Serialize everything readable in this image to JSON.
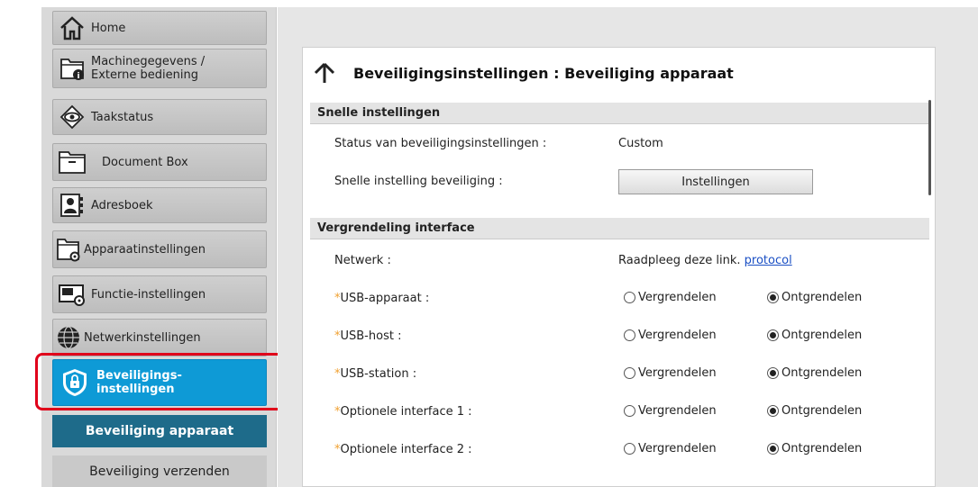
{
  "sidebar": {
    "items": [
      {
        "label": "Home",
        "icon": "home-icon"
      },
      {
        "label_line1": "Machinegegevens /",
        "label_line2": "Externe bediening",
        "icon": "machine-info-icon"
      },
      {
        "label": "Taakstatus",
        "icon": "eye-icon"
      },
      {
        "label": "Document Box",
        "icon": "folder-icon"
      },
      {
        "label": "Adresboek",
        "icon": "address-book-icon"
      },
      {
        "label": "Apparaatinstellingen",
        "icon": "device-settings-icon"
      },
      {
        "label": "Functie-instellingen",
        "icon": "function-settings-icon"
      },
      {
        "label": "Netwerkinstellingen",
        "icon": "globe-icon"
      },
      {
        "label_line1": "Beveiligings-",
        "label_line2": "instellingen",
        "icon": "shield-icon"
      }
    ],
    "sub_items": [
      {
        "label": "Beveiliging apparaat",
        "active": true
      },
      {
        "label": "Beveiliging verzenden",
        "active": false
      }
    ]
  },
  "main": {
    "title": "Beveiligingsinstellingen : Beveiliging apparaat",
    "quick_section": {
      "header": "Snelle instellingen",
      "status_label": "Status van beveiligingsinstellingen :",
      "status_value": "Custom",
      "quick_label": "Snelle instelling beveiliging :",
      "button_label": "Instellingen"
    },
    "interface_section": {
      "header": "Vergrendeling interface",
      "network_label": "Netwerk :",
      "network_text": "Raadpleeg deze link.",
      "network_link": "protocol",
      "required_mark": "*",
      "lock_label": "Vergrendelen",
      "unlock_label": "Ontgrendelen",
      "rows": [
        {
          "label": "USB-apparaat :",
          "value": "Ontgrendelen"
        },
        {
          "label": "USB-host :",
          "value": "Ontgrendelen"
        },
        {
          "label": "USB-station :",
          "value": "Ontgrendelen"
        },
        {
          "label": "Optionele interface 1 :",
          "value": "Ontgrendelen"
        },
        {
          "label": "Optionele interface 2 :",
          "value": "Ontgrendelen"
        }
      ]
    }
  },
  "colors": {
    "accent": "#0e9ad6",
    "sub_active": "#1e6b8a",
    "highlight": "#e0001a",
    "link": "#1a4fc4",
    "required": "#f0a030"
  }
}
